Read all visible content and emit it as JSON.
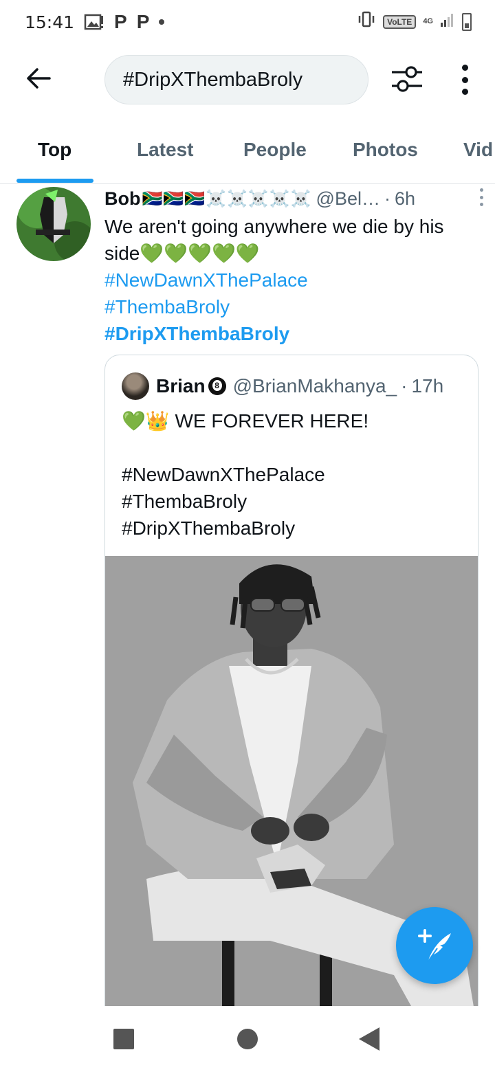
{
  "status_bar": {
    "time": "15:41",
    "notification_p1": "P",
    "notification_p2": "P",
    "volte": "VoLTE",
    "network": "4G"
  },
  "header": {
    "search_value": "#DripXThembaBroly"
  },
  "tabs": [
    {
      "label": "Top",
      "active": true
    },
    {
      "label": "Latest"
    },
    {
      "label": "People"
    },
    {
      "label": "Photos"
    },
    {
      "label": "Vid"
    }
  ],
  "tweet": {
    "name": "Bob",
    "name_emojis": "🇿🇦🇿🇦🇿🇦☠️☠️☠️☠️☠️",
    "handle": "@Bel…",
    "separator": "·",
    "time": "6h",
    "text": "We aren't going anywhere we die by his side💚💚💚💚💚",
    "hashtags": [
      "#NewDawnXThePalace",
      "#ThembaBroly",
      "#DripXThembaBroly"
    ]
  },
  "quote": {
    "name": "Brian",
    "handle": "@BrianMakhanya_",
    "separator": "·",
    "time": "17h",
    "text_line1": "💚👑 WE FOREVER HERE!",
    "hashtags": [
      "#NewDawnXThePalace",
      "#ThembaBroly",
      "#DripXThembaBroly"
    ]
  },
  "icons": {
    "back": "arrow-left-icon",
    "filter": "sliders-icon",
    "more": "more-vertical-icon",
    "compose": "feather-plus-icon"
  },
  "colors": {
    "accent": "#1d9bf0",
    "text_primary": "#0f1419",
    "text_secondary": "#536471"
  }
}
